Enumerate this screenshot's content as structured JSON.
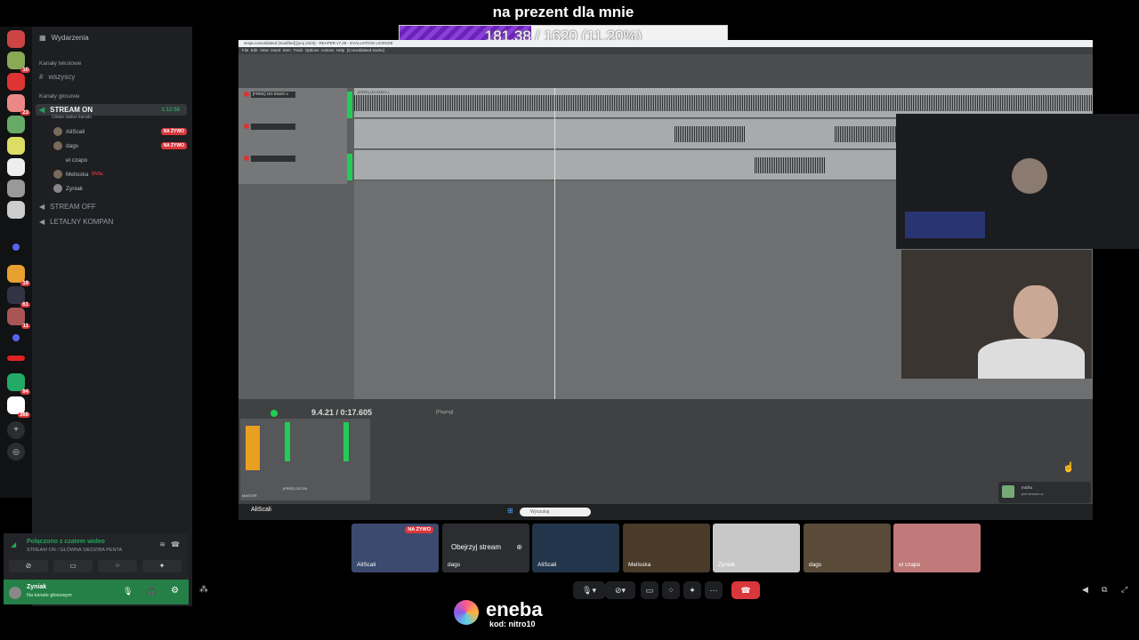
{
  "overlay": {
    "title": "na prezent dla mnie",
    "progress_text": "181.38 / 1620 (11.20%)",
    "progress_fraction": 0.112
  },
  "sidebar": {
    "events": "Wydarzenia",
    "text_category": "Kanały tekstowe",
    "text_channel": "wszyscy",
    "voice_category": "Kanały głosowe",
    "active_channel": "STREAM ON",
    "active_timer": "1:12:58",
    "set_status": "Ustaw status kanału",
    "members": [
      {
        "name": "AliScali",
        "badge": "NA ŻYWO"
      },
      {
        "name": "dags",
        "badge": "NA ŻYWO"
      },
      {
        "name": "el czapo",
        "badge": ""
      },
      {
        "name": "Melisska",
        "badge": "DV0s"
      },
      {
        "name": "Zyniak",
        "badge": ""
      }
    ],
    "channel_off": "STREAM OFF",
    "channel_lethal": "LETALNY KOMPAN",
    "voice_status": "Połączono z czatem wideo",
    "voice_location": "STREAM ON / GŁÓWNA SIEDZIBA PENTA",
    "user_name": "Zyniak",
    "user_status": "Na kanale głosowym"
  },
  "server_badges": [
    "10",
    "23",
    "19",
    "61",
    "11",
    "94",
    "369"
  ],
  "reaper": {
    "title": "sesja-consolidated [modified] [proj 2/2/3] - REAPER v7.28 - EVALUATION LICENSE",
    "menu": [
      "File",
      "Edit",
      "View",
      "Insert",
      "Item",
      "Track",
      "Options",
      "Actions",
      "Help",
      "[Consolidated tracks]"
    ],
    "track_name": "[FREE] OG ENZO x",
    "transport_time": "9.4.21 / 0:17.605",
    "play_state": "[Playing]",
    "mixer_label": "[FREE] OG EN",
    "master_label": "MASTER",
    "search_placeholder": "Wyszukaj",
    "taskbar_user": "AliScali"
  },
  "tiles": [
    {
      "name": "AliScali",
      "badge": "NA ŻYWO"
    },
    {
      "name": "dags",
      "watch": "Obejrzyj stream"
    },
    {
      "name": "AliScali"
    },
    {
      "name": "Melisska"
    },
    {
      "name": "Zyniak"
    },
    {
      "name": "dags"
    },
    {
      "name": "el czapo"
    }
  ],
  "notification": {
    "name": "michu",
    "line": "jest strumin w"
  },
  "sponsor": {
    "brand": "eneba",
    "code": "kod: nitro10"
  },
  "colors": {
    "discord_red": "#da373c",
    "discord_green": "#23a55a",
    "progress_purple": "#8a3fd9"
  }
}
